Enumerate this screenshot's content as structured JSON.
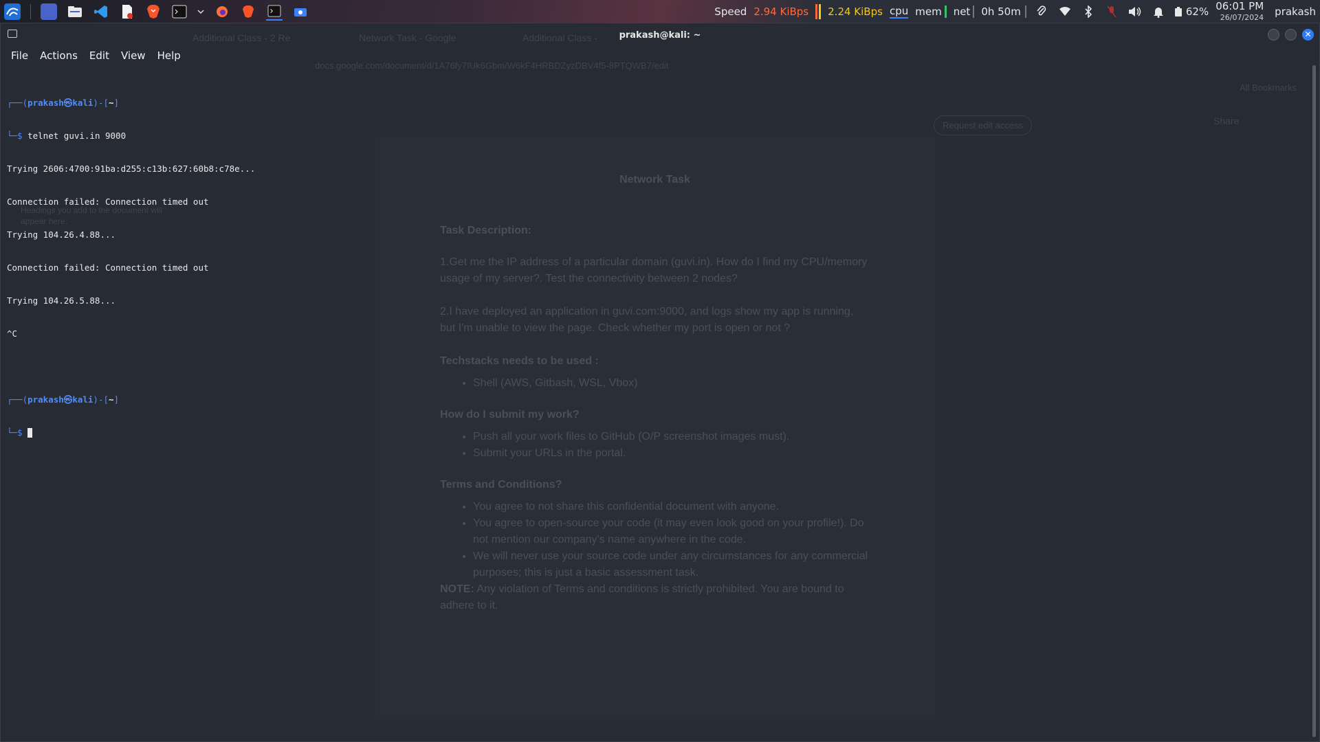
{
  "taskbar": {
    "apps": [
      "kali-menu-icon",
      "workspace-icon",
      "files-icon",
      "vscode-icon",
      "document-icon",
      "brave-icon",
      "terminal-icon",
      "dropdown-icon",
      "firefox-icon",
      "brave-icon-2",
      "terminal-active-icon",
      "screenshot-icon"
    ],
    "speed_label": "Speed",
    "speed_down": "2.94 KiBps",
    "speed_up": "2.24 KiBps",
    "cpu": "cpu",
    "mem": "mem",
    "net": "net",
    "uptime": "0h 50m",
    "battery": "62%",
    "time": "06:01 PM",
    "date": "26/07/2024",
    "user": "prakash",
    "colors": {
      "down": "#ff6a3a",
      "up": "#f3c623"
    }
  },
  "window": {
    "title": "prakash@kali: ~",
    "menu": [
      "File",
      "Actions",
      "Edit",
      "View",
      "Help"
    ]
  },
  "terminal": {
    "user": "prakash",
    "host": "kali",
    "dir": "~",
    "command": "telnet guvi.in 9000",
    "output": [
      "Trying 2606:4700:91ba:d255:c13b:627:60b8:c78e...",
      "Connection failed: Connection timed out",
      "Trying 104.26.4.88...",
      "Connection failed: Connection timed out",
      "Trying 104.26.5.88...",
      "^C"
    ]
  },
  "background": {
    "tabs": [
      "Additional Class - 2 Re",
      "Network Task - Google",
      "Additional Class -"
    ],
    "url": "docs.google.com/document/d/1A76fy7IUk6Gbm/W6kF4HRBDZyzDBV4f5-8PTQWB7/edit",
    "bookmarks": "All Bookmarks",
    "request_edit": "Request edit access",
    "share": "Share",
    "faint_note": "Headings you add to the document will appear here.",
    "doc": {
      "title": "Network Task",
      "task_heading": "Task Description:",
      "p1": "1.Get me the IP address of a particular domain (guvi.in). How do I find my CPU/memory usage of my server?. Test the connectivity between 2 nodes?",
      "p2": "2.I have deployed an application in guvi.com:9000, and logs show my app is running, but I'm unable to view the page. Check whether my port is open or not ?",
      "tech_heading": "Techstacks needs to be used :",
      "tech_items": [
        "Shell (AWS, Gitbash, WSL, Vbox)"
      ],
      "submit_heading": "How do I submit my work?",
      "submit_items": [
        "Push all your work files to GitHub (O/P screenshot images must).",
        "Submit your URLs in the portal."
      ],
      "terms_heading": "Terms and Conditions?",
      "terms_items": [
        "You agree to not share this confidential document with anyone.",
        "You agree to open-source your code (it may even look good on your profile!). Do not mention our company's name anywhere in the code.",
        "We will never use your source code under any circumstances for any commercial purposes; this is just a basic assessment task."
      ],
      "note_label": "NOTE:",
      "note": " Any violation of Terms and conditions is strictly prohibited. You are bound to adhere to it."
    }
  }
}
